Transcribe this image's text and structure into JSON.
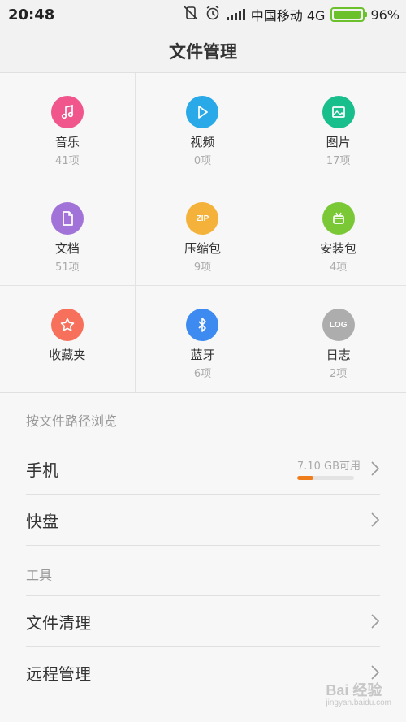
{
  "status_bar": {
    "time": "20:48",
    "carrier": "中国移动 4G",
    "battery_percent": "96%",
    "battery_level": 0.96
  },
  "header": {
    "title": "文件管理"
  },
  "categories": [
    {
      "label": "音乐",
      "count": "41项",
      "color": "#f0558c",
      "icon": "music-note-icon"
    },
    {
      "label": "视频",
      "count": "0项",
      "color": "#29a9e8",
      "icon": "play-icon"
    },
    {
      "label": "图片",
      "count": "17项",
      "color": "#18be8c",
      "icon": "image-icon"
    },
    {
      "label": "文档",
      "count": "51项",
      "color": "#a173d8",
      "icon": "document-icon"
    },
    {
      "label": "压缩包",
      "count": "9项",
      "color": "#f4b23a",
      "icon": "zip-icon",
      "icon_text": "ZIP"
    },
    {
      "label": "安装包",
      "count": "4项",
      "color": "#7ac836",
      "icon": "android-icon"
    },
    {
      "label": "收藏夹",
      "count": "",
      "color": "#f7705c",
      "icon": "star-icon"
    },
    {
      "label": "蓝牙",
      "count": "6项",
      "color": "#3d8af0",
      "icon": "bluetooth-icon"
    },
    {
      "label": "日志",
      "count": "2项",
      "color": "#adadad",
      "icon": "log-icon",
      "icon_text": "LOG"
    }
  ],
  "browse_section": {
    "header": "按文件路径浏览",
    "items": [
      {
        "label": "手机",
        "storage_text": "7.10 GB可用",
        "storage_used_fraction": 0.28
      },
      {
        "label": "快盘"
      }
    ]
  },
  "tools_section": {
    "header": "工具",
    "items": [
      {
        "label": "文件清理"
      },
      {
        "label": "远程管理"
      }
    ]
  },
  "watermark": {
    "text": "Bai 经验",
    "subtext": "jingyan.baidu.com"
  },
  "colors": {
    "accent_storage": "#f07d1c",
    "battery": "#6bc12c"
  }
}
